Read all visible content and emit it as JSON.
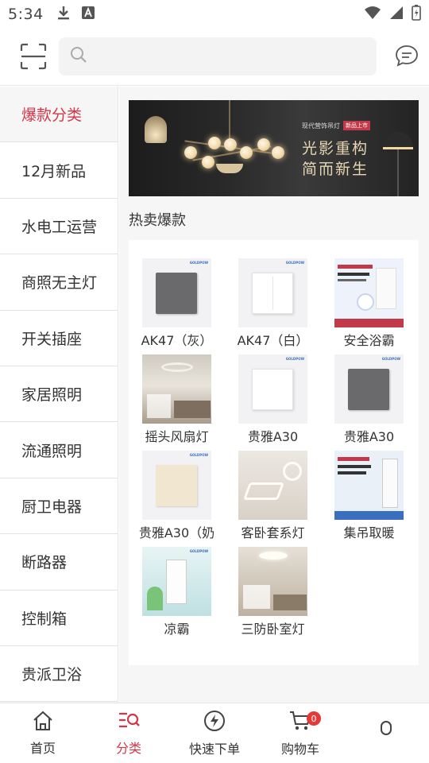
{
  "status_bar": {
    "time": "5:34"
  },
  "search": {
    "placeholder": ""
  },
  "sidebar": {
    "items": [
      {
        "label": "爆款分类",
        "active": true
      },
      {
        "label": "12月新品",
        "active": false
      },
      {
        "label": "水电工运营",
        "active": false
      },
      {
        "label": "商照无主灯",
        "active": false
      },
      {
        "label": "开关插座",
        "active": false
      },
      {
        "label": "家居照明",
        "active": false
      },
      {
        "label": "流通照明",
        "active": false
      },
      {
        "label": "厨卫电器",
        "active": false
      },
      {
        "label": "断路器",
        "active": false
      },
      {
        "label": "控制箱",
        "active": false
      },
      {
        "label": "贵派卫浴",
        "active": false
      }
    ]
  },
  "banner": {
    "small_text": "现代营饰吊灯",
    "tag": "新品上市",
    "title_line1": "光影重构",
    "title_line2": "简而新生"
  },
  "section": {
    "title": "热卖爆款"
  },
  "products": [
    {
      "name": "AK47（灰）",
      "image": "gray-switch-panel"
    },
    {
      "name": "AK47（白）",
      "image": "white-double-switch-panel"
    },
    {
      "name": "安全浴霸",
      "image": "bath-heater-promo"
    },
    {
      "name": "摇头风扇灯",
      "image": "fan-light-room"
    },
    {
      "name": "贵雅A30",
      "image": "white-switch-panel"
    },
    {
      "name": "贵雅A30",
      "image": "gray-switch-panel"
    },
    {
      "name": "贵雅A30（奶",
      "image": "cream-switch-panel"
    },
    {
      "name": "客卧套系灯",
      "image": "ceiling-light-set"
    },
    {
      "name": "集吊取暖",
      "image": "ceiling-heater-promo"
    },
    {
      "name": "凉霸",
      "image": "ceiling-cooler-promo"
    },
    {
      "name": "三防卧室灯",
      "image": "bedroom-ceiling-light"
    }
  ],
  "bottom_nav": {
    "items": [
      {
        "label": "首页",
        "icon": "home-icon",
        "active": false
      },
      {
        "label": "分类",
        "icon": "category-search-icon",
        "active": true
      },
      {
        "label": "快速下单",
        "icon": "lightning-icon",
        "active": false
      },
      {
        "label": "购物车",
        "icon": "cart-icon",
        "active": false,
        "badge": "0"
      },
      {
        "label": "",
        "icon": "profile-icon",
        "active": false
      }
    ]
  },
  "colors": {
    "accent": "#d2374a",
    "sidebar_bg": "#f6f6f6",
    "badge": "#e23a3a"
  }
}
